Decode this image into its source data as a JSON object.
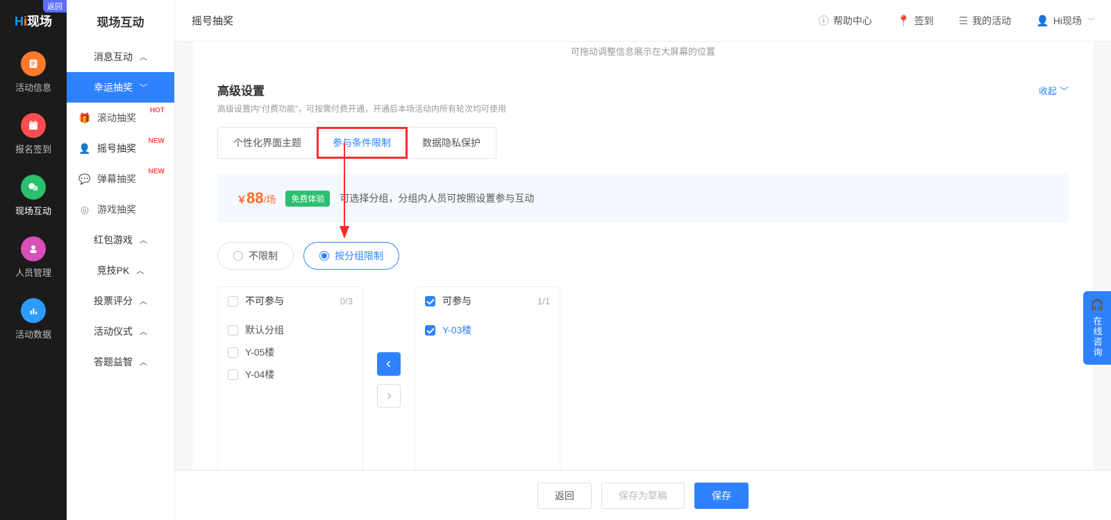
{
  "rail": {
    "back": "返回",
    "items": [
      {
        "label": "活动信息"
      },
      {
        "label": "报名签到"
      },
      {
        "label": "现场互动"
      },
      {
        "label": "人员管理"
      },
      {
        "label": "活动数据"
      }
    ]
  },
  "side": {
    "title": "现场互动",
    "cats": [
      {
        "label": "消息互动",
        "open": false
      },
      {
        "label": "幸运抽奖",
        "open": true,
        "subs": [
          {
            "label": "滚动抽奖",
            "badge": "HOT"
          },
          {
            "label": "摇号抽奖",
            "badge": "NEW",
            "active": true
          },
          {
            "label": "弹幕抽奖",
            "badge": "NEW"
          },
          {
            "label": "游戏抽奖"
          }
        ]
      },
      {
        "label": "红包游戏",
        "open": false
      },
      {
        "label": "竞技PK",
        "open": false
      },
      {
        "label": "投票评分",
        "open": false
      },
      {
        "label": "活动仪式",
        "open": false
      },
      {
        "label": "答题益智",
        "open": false
      }
    ]
  },
  "topbar": {
    "title": "摇号抽奖",
    "links": [
      {
        "label": "帮助中心"
      },
      {
        "label": "签到"
      },
      {
        "label": "我的活动"
      },
      {
        "label": "Hi现场"
      }
    ]
  },
  "content": {
    "trunc_hint": "可拖动调整信息展示在大屏幕的位置",
    "section_title": "高级设置",
    "section_desc": "高级设置内“付费功能”，可按需付费开通，开通后本场活动内所有轮次均可使用",
    "collapse": "收起",
    "tabs": [
      "个性化界面主题",
      "参与条件限制",
      "数据隐私保护"
    ],
    "price": {
      "amount": "88",
      "per": "/场",
      "free": "免费体验",
      "desc": "可选择分组，分组内人员可按照设置参与互动"
    },
    "radios": [
      "不限制",
      "按分组限制"
    ],
    "transfer": {
      "left": {
        "title": "不可参与",
        "count": "0/3",
        "items": [
          "默认分组",
          "Y-05楼",
          "Y-04楼"
        ]
      },
      "right": {
        "title": "可参与",
        "count": "1/1",
        "items": [
          "Y-03楼"
        ]
      }
    }
  },
  "footer": {
    "back": "返回",
    "draft": "保存为草稿",
    "save": "保存"
  },
  "float": "在线咨询"
}
